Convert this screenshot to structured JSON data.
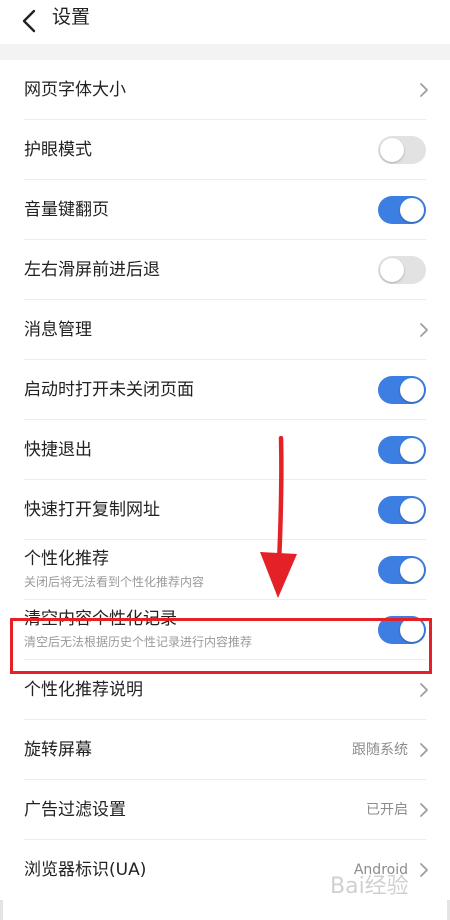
{
  "header": {
    "title": "设置"
  },
  "settings": [
    {
      "label": "网页字体大小",
      "control": "chevron"
    },
    {
      "label": "护眼模式",
      "control": "toggle",
      "on": false
    },
    {
      "label": "音量键翻页",
      "control": "toggle",
      "on": true
    },
    {
      "label": "左右滑屏前进后退",
      "control": "toggle",
      "on": false
    },
    {
      "label": "消息管理",
      "control": "chevron"
    },
    {
      "label": "启动时打开未关闭页面",
      "control": "toggle",
      "on": true
    },
    {
      "label": "快捷退出",
      "control": "toggle",
      "on": true
    },
    {
      "label": "快速打开复制网址",
      "control": "toggle",
      "on": true
    },
    {
      "label": "个性化推荐",
      "sub": "关闭后将无法看到个性化推荐内容",
      "control": "toggle",
      "on": true
    },
    {
      "label": "清空内容个性化记录",
      "sub": "清空后无法根据历史个性记录进行内容推荐",
      "control": "toggle",
      "on": true
    },
    {
      "label": "个性化推荐说明",
      "control": "chevron"
    },
    {
      "label": "旋转屏幕",
      "value": "跟随系统",
      "control": "chevron"
    },
    {
      "label": "广告过滤设置",
      "value": "已开启",
      "control": "chevron"
    },
    {
      "label": "浏览器标识(UA)",
      "value": "Android",
      "control": "chevron"
    }
  ],
  "colors": {
    "accent": "#3d7ee3",
    "toggle_off": "#e2e2e2",
    "highlight": "#e32127"
  },
  "icons": {
    "back": "chevron-left-icon",
    "row_chevron": "chevron-right-icon"
  },
  "watermark": "Bai经验"
}
